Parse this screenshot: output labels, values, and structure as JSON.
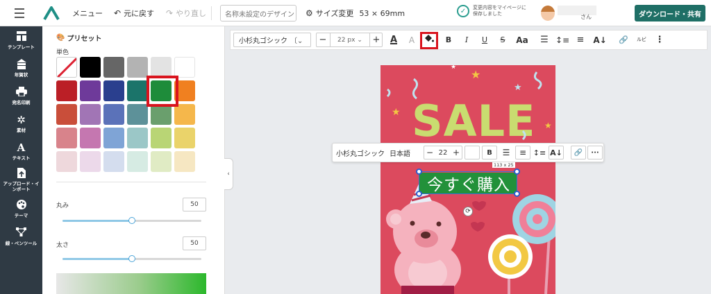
{
  "header": {
    "menu_label": "メニュー",
    "undo_label": "元に戻す",
    "redo_label": "やり直し",
    "design_name_placeholder": "名称未設定のデザイン",
    "resize_label": "サイズ変更",
    "size_value": "53 × 69mm",
    "save_status": "変更内容をマイページに保存しました",
    "user_suffix": "さん",
    "download_label": "ダウンロード・共有"
  },
  "nav": {
    "items": [
      {
        "label": "テンプレート",
        "icon": "template-icon"
      },
      {
        "label": "年賀状",
        "icon": "new-year-card-icon"
      },
      {
        "label": "宛名印刷",
        "icon": "printer-icon"
      },
      {
        "label": "素材",
        "icon": "material-icon"
      },
      {
        "label": "テキスト",
        "icon": "text-icon"
      },
      {
        "label": "アップロード・インポート",
        "icon": "upload-icon"
      },
      {
        "label": "テーマ",
        "icon": "palette-icon"
      },
      {
        "label": "線・ペンツール",
        "icon": "pen-tool-icon"
      }
    ]
  },
  "panel": {
    "preset_title": "プリセット",
    "mono_label": "単色",
    "selected_color": "#1e8c3a",
    "swatch_rows": [
      [
        "none",
        "#000000",
        "#666666",
        "#b3b3b3",
        "#e3e3e3",
        "#ffffff"
      ],
      [
        "#bb1f26",
        "#6e3a9a",
        "#2a3f8e",
        "#1b746a",
        "#1e8c3a",
        "#f08020"
      ],
      [
        "#c94e3a",
        "#a175b5",
        "#5b72b9",
        "#5d9199",
        "#6a9f6d",
        "#f5b74b"
      ],
      [
        "#d8838b",
        "#c577b0",
        "#7fa4d6",
        "#9bc7c7",
        "#b9d575",
        "#ead36a"
      ],
      [
        "#eed8dc",
        "#ecd9ea",
        "#d4ddee",
        "#d6ebe3",
        "#e0ebc4",
        "#f6e7c2"
      ]
    ],
    "roundness_label": "丸み",
    "roundness_value": "50",
    "roundness_fraction": 0.5,
    "thickness_label": "太さ",
    "thickness_value": "50",
    "thickness_fraction": 0.5
  },
  "format_toolbar": {
    "font_name": "小杉丸ゴシック",
    "font_size": "22 px",
    "minus": "−",
    "plus": "+"
  },
  "float_toolbar": {
    "font_name": "小杉丸ゴシック",
    "language": "日本語",
    "font_size": "22",
    "minus": "−",
    "plus": "+"
  },
  "canvas": {
    "sale_text": "SALE",
    "buy_text": "今すぐ購入",
    "size_readout": "113 x 25",
    "background_color": "#dc4a5e",
    "sale_color": "#c9dc70",
    "buy_box_color": "#22913a"
  }
}
